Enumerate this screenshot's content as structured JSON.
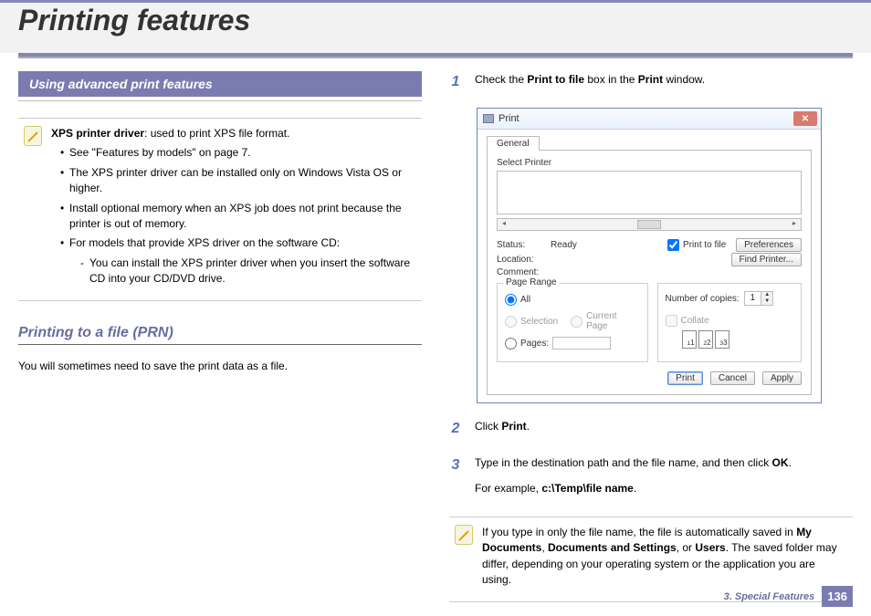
{
  "header": {
    "title": "Printing features"
  },
  "left": {
    "section_bar": "Using advanced print features",
    "note1": {
      "lead_bold": "XPS printer driver",
      "lead_rest": ": used to print XPS file format.",
      "bullets": [
        "See \"Features by models\" on page 7.",
        "The XPS printer driver can be installed only on Windows Vista OS or higher.",
        "Install optional memory when an XPS job does not print because the printer is out of memory.",
        "For models that provide XPS driver on the software CD:"
      ],
      "sub_bullet": "You can install the XPS printer driver when you insert the software CD into your CD/DVD drive."
    },
    "subhead": "Printing to a file (PRN)",
    "intro": "You will sometimes need to save the print data as a file."
  },
  "right": {
    "step1": {
      "num": "1",
      "pre": "Check the ",
      "b1": "Print to file",
      "mid": " box in the ",
      "b2": "Print",
      "post": " window."
    },
    "step2": {
      "num": "2",
      "pre": "Click ",
      "b1": "Print",
      "post": "."
    },
    "step3": {
      "num": "3",
      "pre": "Type in the destination path and the file name, and then click ",
      "b1": "OK",
      "post": ".",
      "example_pre": "For example, ",
      "example_b": "c:\\Temp\\file name",
      "example_post": "."
    },
    "note2": {
      "t1": "If you type in only the file name, the file is automatically saved in ",
      "b1": "My Documents",
      "t2": ", ",
      "b2": "Documents and Settings",
      "t3": ", or ",
      "b3": "Users",
      "t4": ". The saved folder may differ, depending on your operating system or the application you are using."
    }
  },
  "dialog": {
    "title": "Print",
    "tab": "General",
    "select_printer_label": "Select Printer",
    "status_label": "Status:",
    "status_value": "Ready",
    "location_label": "Location:",
    "comment_label": "Comment:",
    "print_to_file": "Print to file",
    "preferences": "Preferences",
    "find_printer": "Find Printer...",
    "page_range_label": "Page Range",
    "all": "All",
    "selection": "Selection",
    "current_page": "Current Page",
    "pages": "Pages:",
    "copies_label": "Number of copies:",
    "copies_value": "1",
    "collate": "Collate",
    "collate_nums": [
      "1",
      "2",
      "3"
    ],
    "btn_print": "Print",
    "btn_cancel": "Cancel",
    "btn_apply": "Apply"
  },
  "footer": {
    "chapter": "3.  Special Features",
    "page": "136"
  }
}
